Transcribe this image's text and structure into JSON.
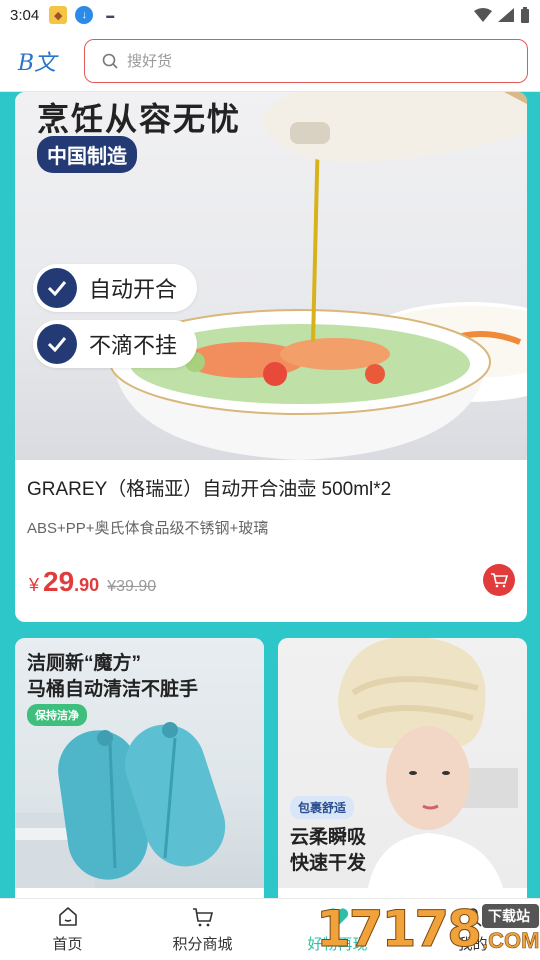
{
  "status_bar": {
    "time": "3:04"
  },
  "header": {
    "logo_text": "B文",
    "search_placeholder": "搜好货"
  },
  "featured": {
    "hero_title": "烹饪从容无忧",
    "hero_badge": "中国制造",
    "features": [
      "自动开合",
      "不滴不挂"
    ],
    "title": "GRAREY（格瑞亚）自动开合油壶 500ml*2",
    "subtitle": "ABS+PP+奥氏体食品级不锈钢+玻璃",
    "price_symbol": "¥",
    "price_int": "29",
    "price_dec": ".90",
    "price_old": "¥39.90"
  },
  "products": [
    {
      "title_lines": [
        "洁厕新“魔方”",
        "马桶自动清洁不脏手"
      ],
      "tag": "保持洁净"
    },
    {
      "title_lines": [
        "云柔瞬吸",
        "快速干发"
      ],
      "tag": "包裹舒适"
    }
  ],
  "tabs": [
    {
      "label": "首页",
      "icon": "home-icon"
    },
    {
      "label": "积分商城",
      "icon": "cart-icon"
    },
    {
      "label": "好物再现",
      "icon": "heart-icon",
      "active": true
    },
    {
      "label": "我的",
      "icon": "user-icon"
    }
  ],
  "watermark": {
    "number": "17178",
    "site": "下载站",
    "domain": ".COM"
  },
  "colors": {
    "accent_teal": "#2ec7c9",
    "price_red": "#e23b3b",
    "active_tab": "#2ebfa6",
    "search_border": "#e15a5a"
  }
}
